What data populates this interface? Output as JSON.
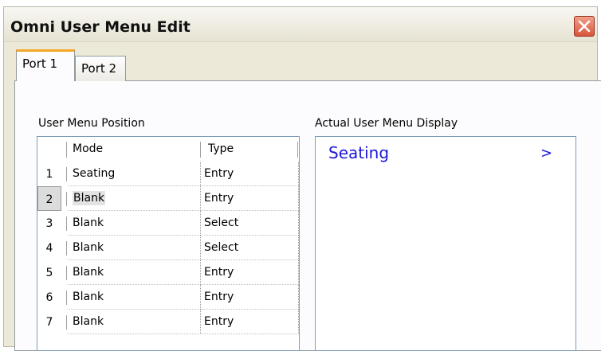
{
  "window": {
    "title": "Omni User Menu Edit"
  },
  "tabs": [
    {
      "label": "Port 1",
      "active": true
    },
    {
      "label": "Port 2",
      "active": false
    }
  ],
  "left_panel": {
    "label": "User Menu Position",
    "columns": [
      "Mode",
      "Type"
    ],
    "rows": [
      {
        "num": "1",
        "mode": "Seating",
        "type": "Entry"
      },
      {
        "num": "2",
        "mode": "Blank",
        "type": "Entry"
      },
      {
        "num": "3",
        "mode": "Blank",
        "type": "Select"
      },
      {
        "num": "4",
        "mode": "Blank",
        "type": "Select"
      },
      {
        "num": "5",
        "mode": "Blank",
        "type": "Entry"
      },
      {
        "num": "6",
        "mode": "Blank",
        "type": "Entry"
      },
      {
        "num": "7",
        "mode": "Blank",
        "type": "Entry"
      }
    ]
  },
  "right_panel": {
    "label": "Actual User Menu Display",
    "display_text": "Seating",
    "display_arrow": ">"
  },
  "colors": {
    "display_text": "#1c18d8",
    "active_tab_accent": "#f5a623",
    "close_button": "#d9553a"
  },
  "icons": {
    "close": "close-icon"
  }
}
